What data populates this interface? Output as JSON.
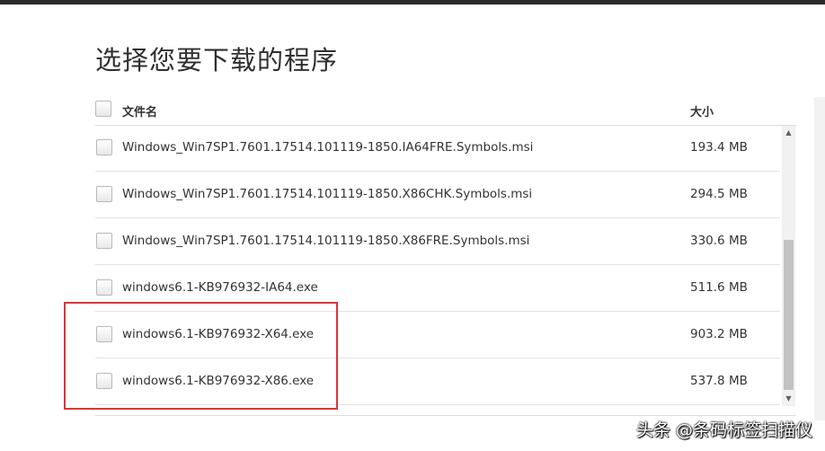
{
  "page": {
    "title": "选择您要下载的程序"
  },
  "table": {
    "header_name": "文件名",
    "header_size": "大小",
    "rows": [
      {
        "name": "Windows_Win7SP1.7601.17514.101119-1850.IA64FRE.Symbols.msi",
        "size": "193.4 MB"
      },
      {
        "name": "Windows_Win7SP1.7601.17514.101119-1850.X86CHK.Symbols.msi",
        "size": "294.5 MB"
      },
      {
        "name": "Windows_Win7SP1.7601.17514.101119-1850.X86FRE.Symbols.msi",
        "size": "330.6 MB"
      },
      {
        "name": "windows6.1-KB976932-IA64.exe",
        "size": "511.6 MB"
      },
      {
        "name": "windows6.1-KB976932-X64.exe",
        "size": "903.2 MB"
      },
      {
        "name": "windows6.1-KB976932-X86.exe",
        "size": "537.8 MB"
      }
    ]
  },
  "scrollbar": {
    "up_icon": "▲",
    "down_icon": "▼"
  },
  "colors": {
    "highlight": "#d9363a"
  },
  "watermark": "头条 @条码标签扫描仪"
}
